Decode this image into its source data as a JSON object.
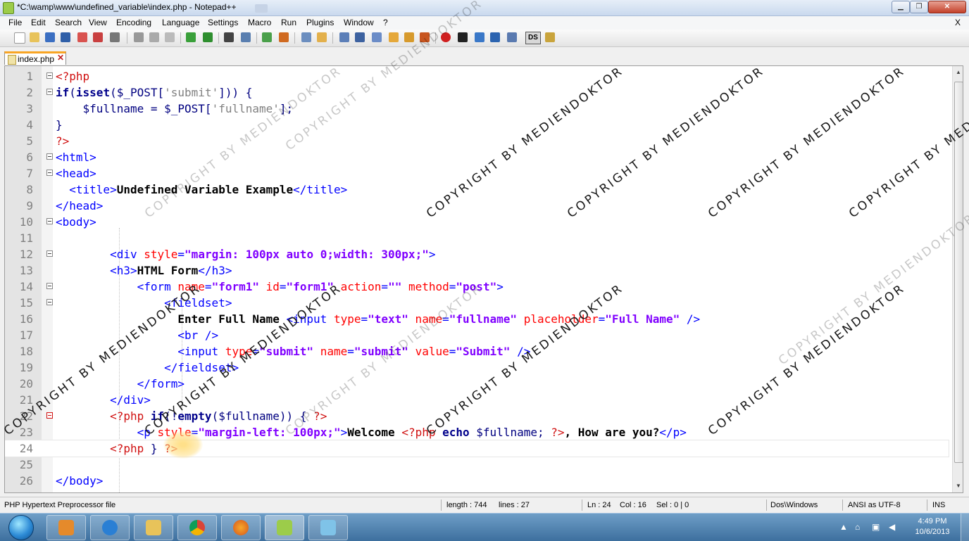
{
  "window": {
    "title": "*C:\\wamp\\www\\undefined_variable\\index.php - Notepad++",
    "min_label": "▁",
    "max_label": "❐",
    "close_label": "✕"
  },
  "menu": {
    "items": [
      "File",
      "Edit",
      "Search",
      "View",
      "Encoding",
      "Language",
      "Settings",
      "Macro",
      "Run",
      "Plugins",
      "Window",
      "?"
    ],
    "close_label": "X"
  },
  "toolbar": {
    "ds_label": "DS"
  },
  "tab": {
    "label": "index.php",
    "close_label": "✕"
  },
  "editor": {
    "lines": [
      {
        "n": "1"
      },
      {
        "n": "2"
      },
      {
        "n": "3"
      },
      {
        "n": "4"
      },
      {
        "n": "5"
      },
      {
        "n": "6"
      },
      {
        "n": "7"
      },
      {
        "n": "8"
      },
      {
        "n": "9"
      },
      {
        "n": "10"
      },
      {
        "n": "11"
      },
      {
        "n": "12"
      },
      {
        "n": "13"
      },
      {
        "n": "14"
      },
      {
        "n": "15"
      },
      {
        "n": "16"
      },
      {
        "n": "17"
      },
      {
        "n": "18"
      },
      {
        "n": "19"
      },
      {
        "n": "20"
      },
      {
        "n": "21"
      },
      {
        "n": "22"
      },
      {
        "n": "23"
      },
      {
        "n": "24"
      },
      {
        "n": "25"
      },
      {
        "n": "26"
      }
    ],
    "code": {
      "l1a": "<?php",
      "l2a": "if",
      "l2b": "(",
      "l2c": "isset",
      "l2d": "($_POST[",
      "l2e": "'submit'",
      "l2f": "])) {",
      "l3a": "    $fullname = $_POST[",
      "l3b": "'fullname'",
      "l3c": "];",
      "l4a": "}",
      "l5a": "?>",
      "l6a": "<html>",
      "l7a": "<head>",
      "l8a": "  <title>",
      "l8b": "Undefined Variable Example",
      "l8c": "</title>",
      "l9a": "</head>",
      "l10a": "<body>",
      "l12a": "        <div ",
      "l12b": "style",
      "l12c": "=",
      "l12d": "\"margin: 100px auto 0;width: 300px;\"",
      "l12e": ">",
      "l13a": "        <h3>",
      "l13b": "HTML Form",
      "l13c": "</h3>",
      "l14a": "            <form ",
      "l14b": "name",
      "l14c": "=",
      "l14d": "\"form1\"",
      "l14e": " id",
      "l14f": "=",
      "l14g": "\"form1\"",
      "l14h": " action",
      "l14i": "=",
      "l14j": "\"\"",
      "l14k": " method",
      "l14l": "=",
      "l14m": "\"post\"",
      "l14n": ">",
      "l15a": "                <fieldset>",
      "l16a": "                  ",
      "l16b": "Enter Full Name ",
      "l16c": "<input ",
      "l16d": "type",
      "l16e": "=",
      "l16f": "\"text\"",
      "l16g": " name",
      "l16h": "=",
      "l16i": "\"fullname\"",
      "l16j": " placeholder",
      "l16k": "=",
      "l16l": "\"Full Name\"",
      "l16m": " />",
      "l17a": "                  <br />",
      "l18a": "                  <input ",
      "l18b": "type",
      "l18c": "=",
      "l18d": "\"submit\"",
      "l18e": " name",
      "l18f": "=",
      "l18g": "\"submit\"",
      "l18h": " value",
      "l18i": "=",
      "l18j": "\"Submit\"",
      "l18k": " />",
      "l19a": "                </fieldset>",
      "l20a": "            </form>",
      "l21a": "        </div>",
      "l22a": "        <?php ",
      "l22b": "if",
      "l22c": "(!",
      "l22d": "empty",
      "l22e": "($fullname)) {",
      "l22f": " ?>",
      "l23a": "            <p ",
      "l23b": "style",
      "l23c": "=",
      "l23d": "\"margin-left: 100px;\"",
      "l23e": ">",
      "l23f": "Welcome ",
      "l23g": "<?php ",
      "l23h": "echo",
      "l23i": " $fullname; ",
      "l23j": "?>",
      "l23k": ", How are you?",
      "l23l": "</p>",
      "l24a": "        <?php ",
      "l24b": "}",
      "l24c": " ?>",
      "l26a": "</body>"
    }
  },
  "status": {
    "file_type": "PHP Hypertext Preprocessor file",
    "length": "length : 744",
    "lines": "lines : 27",
    "ln": "Ln : 24",
    "col": "Col : 16",
    "sel": "Sel : 0 | 0",
    "eol": "Dos\\Windows",
    "encoding": "ANSI as UTF-8",
    "mode": "INS"
  },
  "taskbar": {
    "time": "4:49 PM",
    "date": "10/6/2013"
  },
  "watermark": {
    "text": "COPYRIGHT BY MEDIENDOKTOR"
  },
  "colors": {
    "tab_accent": "#f8a524",
    "php_tag": "#d01010",
    "html_tag": "#0000ff",
    "attr_name": "#ff0000",
    "attr_value": "#8000ff"
  }
}
